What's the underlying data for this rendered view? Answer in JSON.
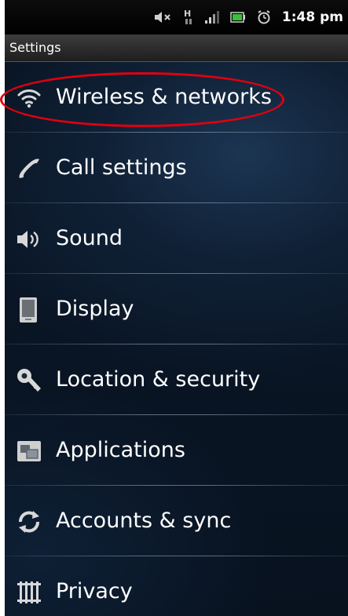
{
  "status_bar": {
    "time": "1:48 pm",
    "icons": [
      "mute-icon",
      "hspa-data-icon",
      "signal-icon",
      "battery-icon",
      "alarm-icon"
    ],
    "network_letter": "H"
  },
  "title_bar": {
    "title": "Settings"
  },
  "settings_list": [
    {
      "label": "Wireless & networks",
      "icon": "wifi-icon"
    },
    {
      "label": "Call settings",
      "icon": "phone-handset-icon"
    },
    {
      "label": "Sound",
      "icon": "speaker-icon"
    },
    {
      "label": "Display",
      "icon": "display-icon"
    },
    {
      "label": "Location & security",
      "icon": "location-security-icon"
    },
    {
      "label": "Applications",
      "icon": "applications-icon"
    },
    {
      "label": "Accounts & sync",
      "icon": "sync-icon"
    },
    {
      "label": "Privacy",
      "icon": "privacy-icon"
    }
  ],
  "colors": {
    "highlight_ellipse": "#e00010",
    "background": "#0a1626",
    "text": "#ffffff"
  }
}
